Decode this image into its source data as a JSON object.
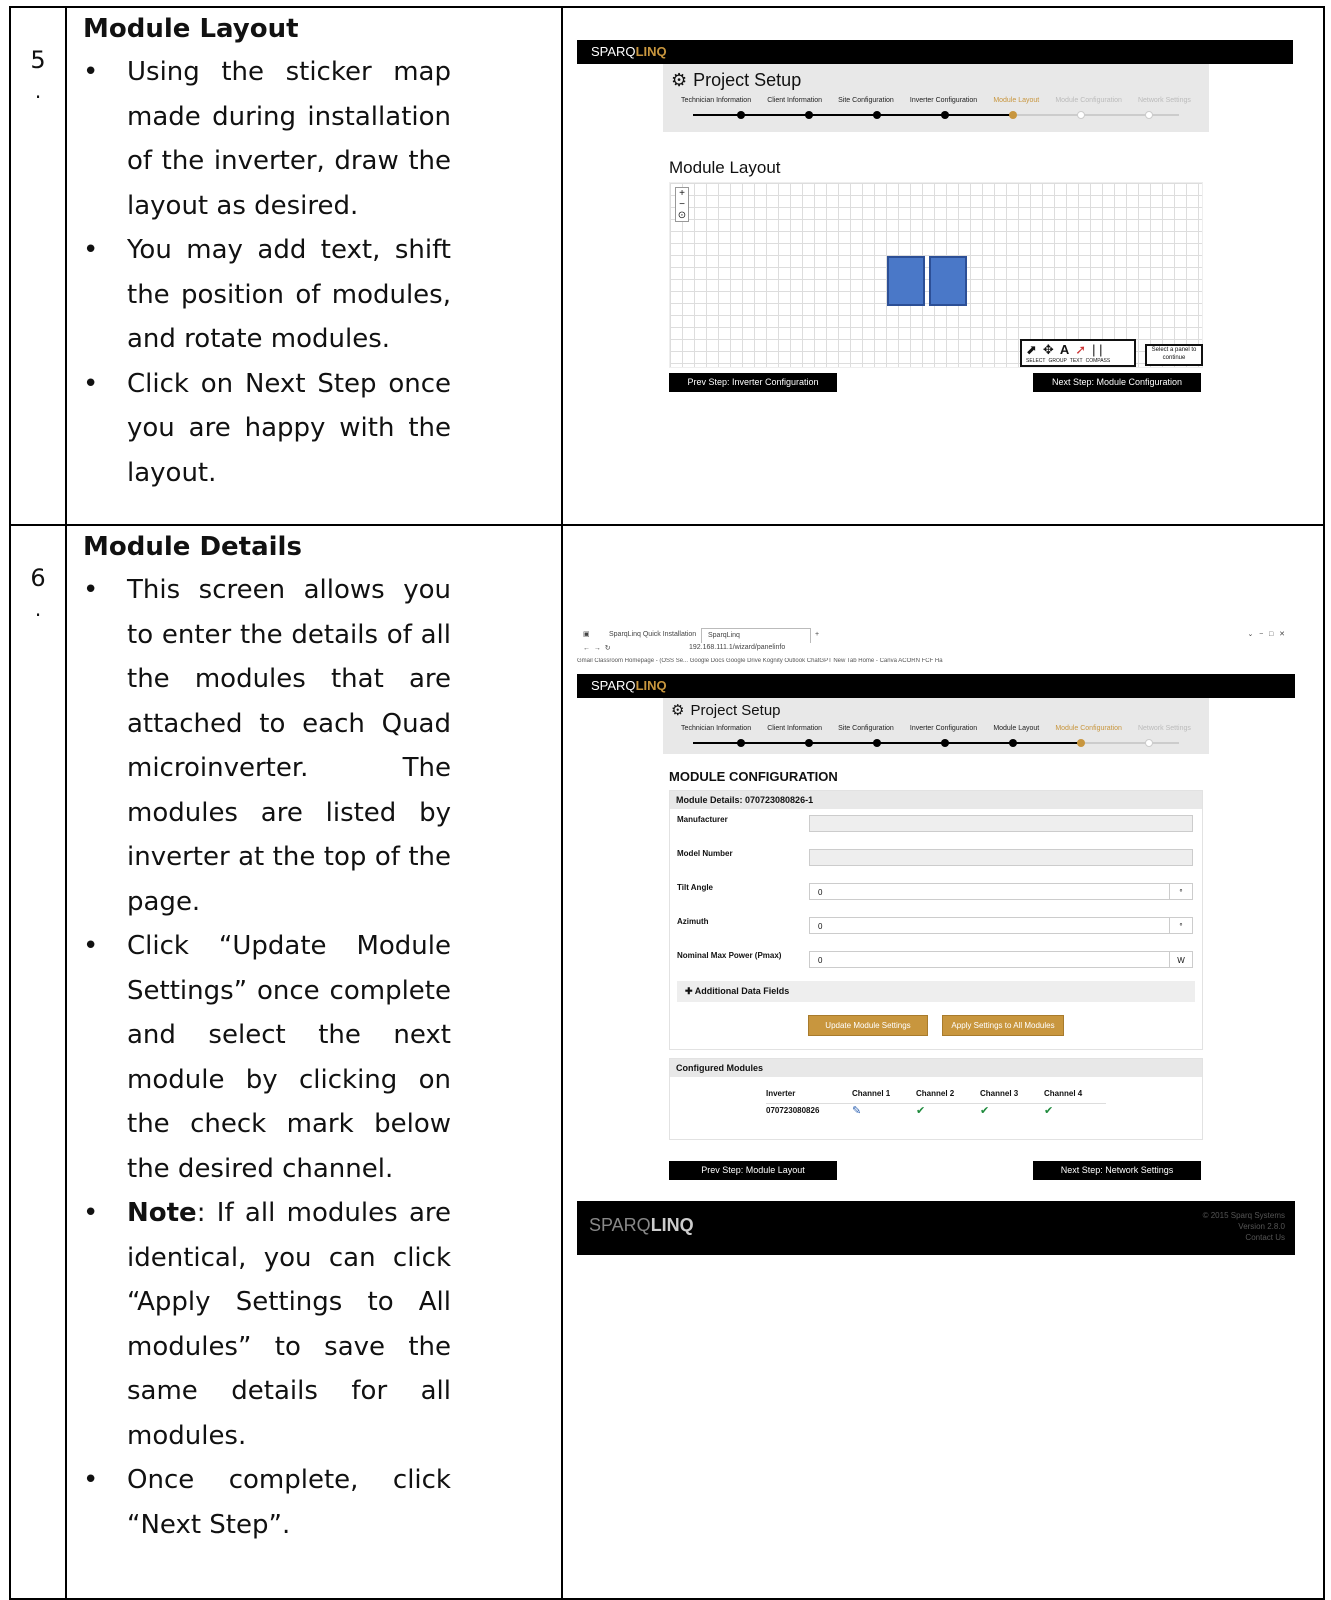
{
  "steps": [
    {
      "number": "5",
      "dot": ".",
      "title": "Module Layout",
      "bullets": [
        "Using the sticker map made during installation of the inverter, draw the layout as desired.",
        "You may add text, shift the position of modules, and rotate modules.",
        "Click on Next Step once you are happy with the layout."
      ]
    },
    {
      "number": "6",
      "dot": ".",
      "title": "Module Details",
      "bullets": [
        "This screen allows you to enter the details of all the modules that are attached to each Quad microinverter. The modules are listed by inverter at the top of the page.",
        "Click “Update Module Settings” once complete and select the next module by clicking on the check mark below the desired channel.",
        "Once complete, click “Next Step”."
      ],
      "note_label": "Note",
      "note_text": ": If all modules are identical, you can click “Apply Settings to All modules” to save the same details for all modules."
    }
  ],
  "app": {
    "brand_a": "SPARQ",
    "brand_b": "LINQ",
    "project_setup": "Project Setup",
    "wizard_steps": [
      "Technician Information",
      "Client Information",
      "Site Configuration",
      "Inverter Configuration",
      "Module Layout",
      "Module Configuration",
      "Network Settings"
    ]
  },
  "screen1": {
    "heading": "Module Layout",
    "toolbar_labels": [
      "SELECT",
      "GROUP",
      "TEXT",
      "COMPASS"
    ],
    "hint": "Select a panel to continue",
    "prev_btn": "Prev Step: Inverter Configuration",
    "next_btn": "Next Step: Module Configuration"
  },
  "screen2": {
    "tab1": "SparqLinq Quick Installation",
    "tab2": "SparqLinq",
    "url": "192.168.111.1/wizard/panelinfo",
    "bookmarks": "Gmail  Classroom  Homepage - (OSS Se...  Google Docs  Google Drive  Kognity  Outlook  ChatGPT  New Tab  Home - Canva  ACORN  FCF Ha",
    "heading": "MODULE CONFIGURATION",
    "details_head": "Module Details: 070723080826-1",
    "fields": [
      {
        "label": "Manufacturer",
        "value": "",
        "unit": ""
      },
      {
        "label": "Model Number",
        "value": "",
        "unit": ""
      },
      {
        "label": "Tilt Angle",
        "value": "0",
        "unit": "°"
      },
      {
        "label": "Azimuth",
        "value": "0",
        "unit": "°"
      },
      {
        "label": "Nominal Max Power (Pmax)",
        "value": "0",
        "unit": "W"
      }
    ],
    "additional": "Additional Data Fields",
    "update_btn": "Update Module Settings",
    "apply_btn": "Apply Settings to All Modules",
    "configured_head": "Configured Modules",
    "col_inverter": "Inverter",
    "channels": [
      "Channel 1",
      "Channel 2",
      "Channel 3",
      "Channel 4"
    ],
    "inverter_id": "070723080826",
    "prev_btn": "Prev Step: Module Layout",
    "next_btn": "Next Step: Network Settings",
    "footer_lines": [
      "© 2015 Sparq Systems",
      "Version 2.8.0",
      "Contact Us"
    ]
  }
}
